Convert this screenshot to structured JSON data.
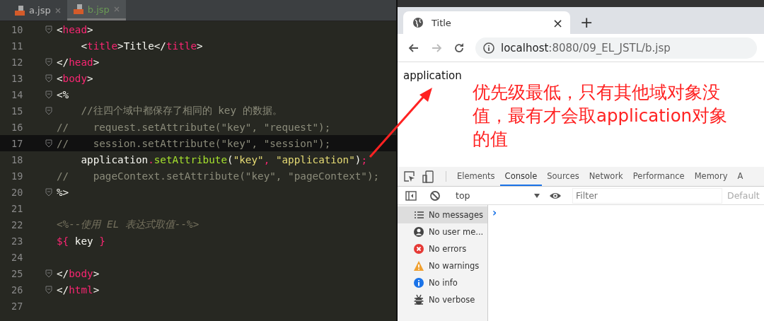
{
  "editor": {
    "tabs": [
      {
        "label": "a.jsp",
        "selected": false
      },
      {
        "label": "b.jsp",
        "selected": true
      }
    ],
    "lines": [
      {
        "number": "10",
        "fold": true,
        "current": false,
        "segments": [
          {
            "kind": "plain",
            "text": "<"
          },
          {
            "kind": "tag",
            "text": "head"
          },
          {
            "kind": "plain",
            "text": ">"
          }
        ]
      },
      {
        "number": "11",
        "fold": false,
        "current": false,
        "segments": [
          {
            "kind": "plain",
            "text": "    <"
          },
          {
            "kind": "tag",
            "text": "title"
          },
          {
            "kind": "plain",
            "text": ">Title</"
          },
          {
            "kind": "tag",
            "text": "title"
          },
          {
            "kind": "plain",
            "text": ">"
          }
        ]
      },
      {
        "number": "12",
        "fold": true,
        "current": false,
        "segments": [
          {
            "kind": "plain",
            "text": "</"
          },
          {
            "kind": "tag",
            "text": "head"
          },
          {
            "kind": "plain",
            "text": ">"
          }
        ]
      },
      {
        "number": "13",
        "fold": true,
        "current": false,
        "segments": [
          {
            "kind": "plain",
            "text": "<"
          },
          {
            "kind": "tag",
            "text": "body"
          },
          {
            "kind": "plain",
            "text": ">"
          }
        ]
      },
      {
        "number": "14",
        "fold": true,
        "current": false,
        "segments": [
          {
            "kind": "plain",
            "text": "<%"
          }
        ]
      },
      {
        "number": "15",
        "fold": true,
        "current": false,
        "segments": [
          {
            "kind": "comment",
            "text": "    //往四个域中都保存了相同的 key 的数据。"
          }
        ]
      },
      {
        "number": "16",
        "fold": false,
        "current": false,
        "segments": [
          {
            "kind": "comment",
            "text": "//    request.setAttribute(\"key\", \"request\");"
          }
        ]
      },
      {
        "number": "17",
        "fold": true,
        "current": true,
        "segments": [
          {
            "kind": "comment",
            "text": "//    session.setAttribute(\"key\", \"session\");"
          }
        ]
      },
      {
        "number": "18",
        "fold": false,
        "current": false,
        "segments": [
          {
            "kind": "plain",
            "text": "    application"
          },
          {
            "kind": "punct",
            "text": "."
          },
          {
            "kind": "method",
            "text": "setAttribute"
          },
          {
            "kind": "plain",
            "text": "("
          },
          {
            "kind": "string",
            "text": "\"key\""
          },
          {
            "kind": "punct",
            "text": ", "
          },
          {
            "kind": "string",
            "text": "\"application\""
          },
          {
            "kind": "plain",
            "text": ")"
          },
          {
            "kind": "punct",
            "text": ";"
          }
        ]
      },
      {
        "number": "19",
        "fold": false,
        "current": false,
        "segments": [
          {
            "kind": "comment",
            "text": "//    pageContext.setAttribute(\"key\", \"pageContext\");"
          }
        ]
      },
      {
        "number": "20",
        "fold": true,
        "current": false,
        "segments": [
          {
            "kind": "plain",
            "text": "%>"
          }
        ]
      },
      {
        "number": "21",
        "fold": false,
        "current": false
      },
      {
        "number": "22",
        "fold": false,
        "current": false,
        "segments": [
          {
            "kind": "jspcomment",
            "text": "<%--使用 EL 表达式取值--%>"
          }
        ]
      },
      {
        "number": "23",
        "fold": false,
        "current": false,
        "segments": [
          {
            "kind": "tag",
            "text": "${"
          },
          {
            "kind": "plain",
            "text": " key "
          },
          {
            "kind": "tag",
            "text": "}"
          }
        ]
      },
      {
        "number": "24",
        "fold": false,
        "current": false
      },
      {
        "number": "25",
        "fold": true,
        "current": false,
        "segments": [
          {
            "kind": "plain",
            "text": "</"
          },
          {
            "kind": "tag",
            "text": "body"
          },
          {
            "kind": "plain",
            "text": ">"
          }
        ]
      },
      {
        "number": "26",
        "fold": true,
        "current": false,
        "segments": [
          {
            "kind": "plain",
            "text": "</"
          },
          {
            "kind": "tag",
            "text": "html"
          },
          {
            "kind": "plain",
            "text": ">"
          }
        ]
      },
      {
        "number": "27",
        "fold": false,
        "current": false
      }
    ]
  },
  "browser": {
    "tab": {
      "title": "Title",
      "close": "×"
    },
    "new_tab": "+",
    "address": {
      "host": "localhost",
      "path": ":8080/09_EL_JSTL/b.jsp"
    },
    "page_text": "application",
    "annotation": "优先级最低，只有其他域对象没值，最有才会取application对象的值",
    "devtools": {
      "tabs": [
        {
          "label": "Elements",
          "selected": false
        },
        {
          "label": "Console",
          "selected": true
        },
        {
          "label": "Sources",
          "selected": false
        },
        {
          "label": "Network",
          "selected": false
        },
        {
          "label": "Performance",
          "selected": false
        },
        {
          "label": "Memory",
          "selected": false
        },
        {
          "label": "A",
          "selected": false
        }
      ],
      "context": "top",
      "filter_placeholder": "Filter",
      "levels": "Default",
      "sidebar": [
        {
          "kind": "messages",
          "label": "No messages",
          "selected": true
        },
        {
          "kind": "user",
          "label": "No user me...",
          "selected": false
        },
        {
          "kind": "errors",
          "label": "No errors",
          "selected": false
        },
        {
          "kind": "warnings",
          "label": "No warnings",
          "selected": false
        },
        {
          "kind": "info",
          "label": "No info",
          "selected": false
        },
        {
          "kind": "verbose",
          "label": "No verbose",
          "selected": false
        }
      ],
      "prompt": "›"
    }
  }
}
